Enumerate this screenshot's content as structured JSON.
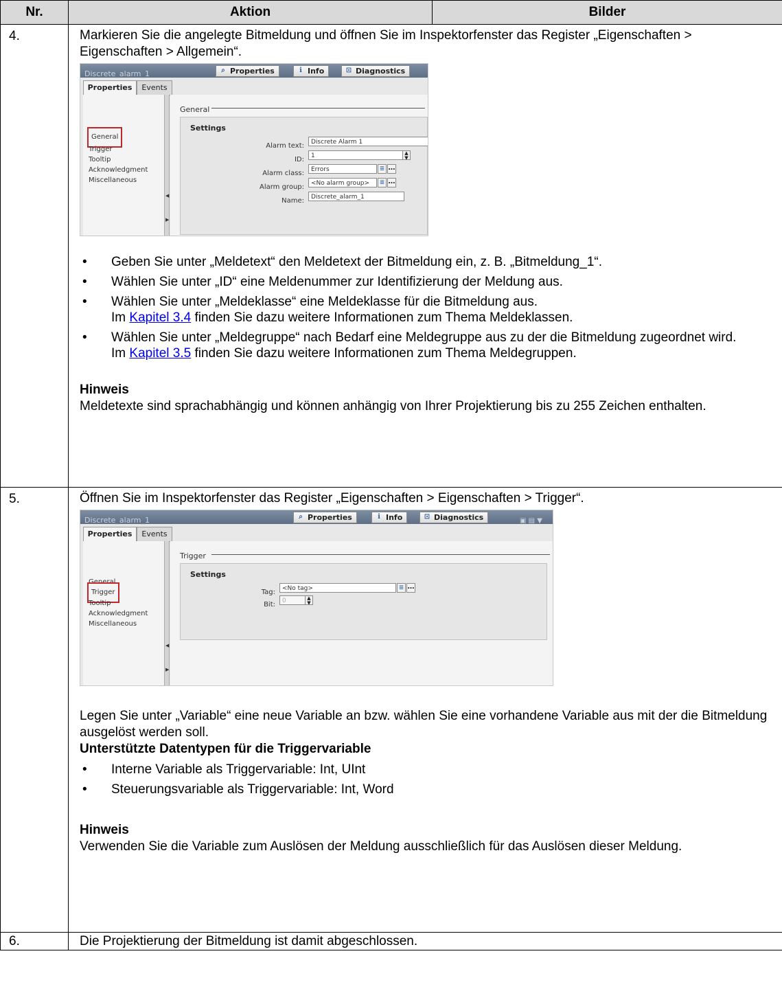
{
  "header": {
    "nr": "Nr.",
    "aktion": "Aktion",
    "bilder": "Bilder"
  },
  "rows": [
    {
      "nr": "4.",
      "intro": "Markieren Sie die angelegte Bitmeldung und öffnen Sie im Inspektorfenster das Register „Eigenschaften > Eigenschaften > Allgemein“.",
      "shot": {
        "title": "Discrete_alarm_1",
        "tabs_top": [
          "Properties",
          "Info",
          "Diagnostics"
        ],
        "tabs": [
          "Properties",
          "Events"
        ],
        "nav": [
          "General",
          "Trigger",
          "Tooltip",
          "Acknowledgment",
          "Miscellaneous"
        ],
        "selected_nav": "General",
        "section": "General",
        "box_title": "Settings",
        "fields": [
          {
            "label": "Alarm text:",
            "value": "Discrete Alarm 1"
          },
          {
            "label": "ID:",
            "value": "1"
          },
          {
            "label": "Alarm class:",
            "value": "Errors"
          },
          {
            "label": "Alarm group:",
            "value": "<No alarm group>"
          },
          {
            "label": "Name:",
            "value": "Discrete_alarm_1"
          }
        ]
      },
      "bullets": [
        {
          "text": "Geben Sie unter „Meldetext“ den Meldetext der Bitmeldung ein, z. B. „Bitmeldung_1“."
        },
        {
          "text": "Wählen Sie unter „ID“ eine Meldenummer zur Identifizierung der Meldung aus."
        },
        {
          "text": "Wählen Sie unter „Meldeklasse“ eine Meldeklasse für die Bitmeldung aus.",
          "pre": "Im ",
          "link": "Kapitel 3.4",
          "post": " finden Sie dazu weitere Informationen zum Thema Meldeklassen."
        },
        {
          "text": "Wählen Sie unter „Meldegruppe“ nach Bedarf eine Meldegruppe aus zu der die Bitmeldung zugeordnet wird.",
          "pre": "Im ",
          "link": "Kapitel 3.5",
          "post": " finden Sie dazu weitere Informationen zum Thema Meldegruppen."
        }
      ],
      "note_title": "Hinweis",
      "note_text": "Meldetexte sind sprachabhängig und können anhängig von Ihrer Projektierung bis zu 255 Zeichen enthalten."
    },
    {
      "nr": "5.",
      "intro": "Öffnen Sie im Inspektorfenster das Register „Eigenschaften > Eigenschaften > Trigger“.",
      "shot": {
        "title": "Discrete_alarm_1",
        "tabs_top": [
          "Properties",
          "Info",
          "Diagnostics"
        ],
        "tabs": [
          "Properties",
          "Events"
        ],
        "nav": [
          "General",
          "Trigger",
          "Tooltip",
          "Acknowledgment",
          "Miscellaneous"
        ],
        "selected_nav": "Trigger",
        "section": "Trigger",
        "box_title": "Settings",
        "fields": [
          {
            "label": "Tag:",
            "value": "<No tag>"
          },
          {
            "label": "Bit:",
            "value": "0"
          }
        ]
      },
      "text": "Legen Sie unter „Variable“ eine neue Variable an bzw. wählen Sie eine vorhandene Variable aus mit der die Bitmeldung ausgelöst werden soll.",
      "sub_title": "Unterstützte Datentypen für die Triggervariable",
      "bullets": [
        {
          "text": "Interne Variable als Triggervariable: Int, UInt"
        },
        {
          "text": "Steuerungsvariable als Triggervariable: Int, Word"
        }
      ],
      "note_title": "Hinweis",
      "note_text": "Verwenden Sie die Variable zum Auslösen der Meldung ausschließlich für das Auslösen dieser Meldung."
    },
    {
      "nr": "6.",
      "text": "Die Projektierung der Bitmeldung ist damit abgeschlossen."
    }
  ]
}
